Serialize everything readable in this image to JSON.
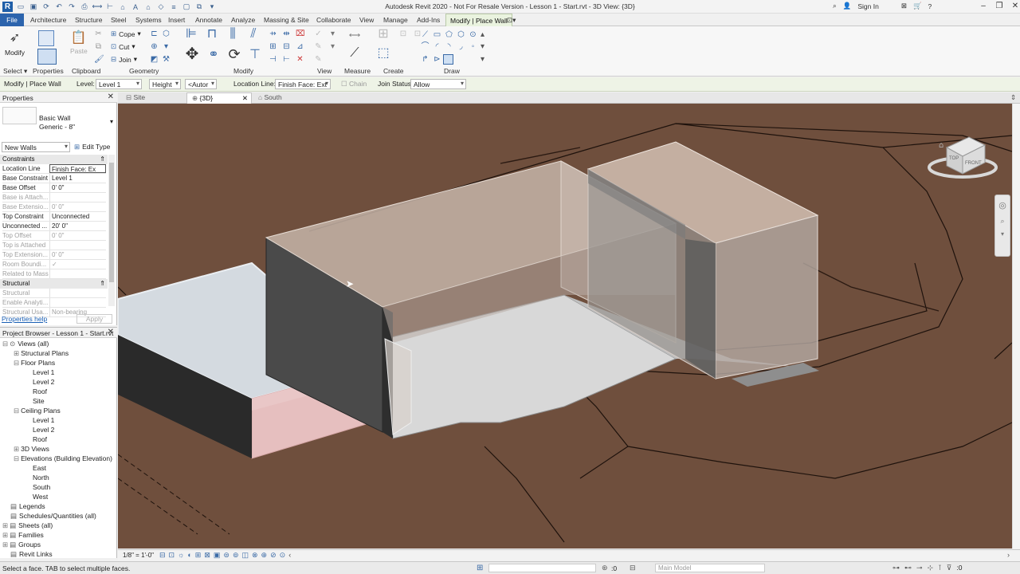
{
  "app": {
    "title": "Autodesk Revit 2020 - Not For Resale Version - Lesson 1 - Start.rvt - 3D View: {3D}",
    "sign_in": "Sign In"
  },
  "menu_tabs": [
    "File",
    "Architecture",
    "Structure",
    "Steel",
    "Systems",
    "Insert",
    "Annotate",
    "Analyze",
    "Massing & Site",
    "Collaborate",
    "View",
    "Manage",
    "Add-Ins",
    "Modify | Place Wall"
  ],
  "ribbon": {
    "modify": "Modify",
    "paste": "Paste",
    "cope": "Cope",
    "cut": "Cut",
    "join": "Join",
    "panels": {
      "select": "Select",
      "properties": "Properties",
      "clipboard": "Clipboard",
      "geometry": "Geometry",
      "modify": "Modify",
      "view": "View",
      "measure": "Measure",
      "create": "Create",
      "draw": "Draw"
    }
  },
  "options_bar": {
    "context": "Modify | Place Wall",
    "level_label": "Level:",
    "level_value": "Level 1",
    "height_value": "Height",
    "autor_value": "<Autor",
    "location_label": "Location Line:",
    "location_value": "Finish Face: Ext",
    "chain": "Chain",
    "join_label": "Join Status:",
    "join_value": "Allow"
  },
  "properties": {
    "header": "Properties",
    "type_family": "Basic Wall",
    "type_name": "Generic - 8\"",
    "filter": "New Walls",
    "edit_type": "Edit Type",
    "constraints_title": "Constraints",
    "rows": [
      {
        "k": "Location Line",
        "v": "Finish Face: Ex",
        "dis": false
      },
      {
        "k": "Base Constraint",
        "v": "Level 1",
        "dis": false
      },
      {
        "k": "Base Offset",
        "v": "0'  0\"",
        "dis": false
      },
      {
        "k": "Base is Attach...",
        "v": "",
        "dis": true
      },
      {
        "k": "Base Extensio...",
        "v": "0'  0\"",
        "dis": true
      },
      {
        "k": "Top Constraint",
        "v": "Unconnected",
        "dis": false
      },
      {
        "k": "Unconnected ...",
        "v": "20'  0\"",
        "dis": false
      },
      {
        "k": "Top Offset",
        "v": "0'  0\"",
        "dis": true
      },
      {
        "k": "Top is Attached",
        "v": "",
        "dis": true
      },
      {
        "k": "Top Extension...",
        "v": "0'  0\"",
        "dis": true
      },
      {
        "k": "Room Boundi...",
        "v": "✓",
        "dis": true
      },
      {
        "k": "Related to Mass",
        "v": "",
        "dis": true
      }
    ],
    "structural_title": "Structural",
    "structural_rows": [
      {
        "k": "Structural",
        "v": "",
        "dis": true
      },
      {
        "k": "Enable Analyti...",
        "v": "",
        "dis": true
      },
      {
        "k": "Structural Usa...",
        "v": "Non-bearing",
        "dis": true
      }
    ],
    "help": "Properties help",
    "apply": "Apply"
  },
  "browser": {
    "header": "Project Browser - Lesson 1 - Start.rvt",
    "items": [
      {
        "label": "Views (all)",
        "indent": 0,
        "exp": "⊟"
      },
      {
        "label": "Structural Plans",
        "indent": 1,
        "exp": "⊞"
      },
      {
        "label": "Floor Plans",
        "indent": 1,
        "exp": "⊟"
      },
      {
        "label": "Level 1",
        "indent": 2,
        "exp": ""
      },
      {
        "label": "Level 2",
        "indent": 2,
        "exp": ""
      },
      {
        "label": "Roof",
        "indent": 2,
        "exp": ""
      },
      {
        "label": "Site",
        "indent": 2,
        "exp": ""
      },
      {
        "label": "Ceiling Plans",
        "indent": 1,
        "exp": "⊟"
      },
      {
        "label": "Level 1",
        "indent": 2,
        "exp": ""
      },
      {
        "label": "Level 2",
        "indent": 2,
        "exp": ""
      },
      {
        "label": "Roof",
        "indent": 2,
        "exp": ""
      },
      {
        "label": "3D Views",
        "indent": 1,
        "exp": "⊞"
      },
      {
        "label": "Elevations (Building Elevation)",
        "indent": 1,
        "exp": "⊟"
      },
      {
        "label": "East",
        "indent": 2,
        "exp": ""
      },
      {
        "label": "North",
        "indent": 2,
        "exp": ""
      },
      {
        "label": "South",
        "indent": 2,
        "exp": ""
      },
      {
        "label": "West",
        "indent": 2,
        "exp": ""
      },
      {
        "label": "Legends",
        "indent": 0,
        "exp": ""
      },
      {
        "label": "Schedules/Quantities (all)",
        "indent": 0,
        "exp": ""
      },
      {
        "label": "Sheets (all)",
        "indent": 0,
        "exp": "⊞"
      },
      {
        "label": "Families",
        "indent": 0,
        "exp": "⊞"
      },
      {
        "label": "Groups",
        "indent": 0,
        "exp": "⊞"
      },
      {
        "label": "Revit Links",
        "indent": 0,
        "exp": ""
      }
    ]
  },
  "view_tabs": [
    "Site",
    "{3D}",
    "South"
  ],
  "viewcube": {
    "top": "TOP",
    "front": "FRONT"
  },
  "view_control": {
    "scale": "1/8\" = 1'-0\""
  },
  "status": {
    "message": "Select a face.  TAB to select multiple faces.",
    "workset": ":0",
    "model": "Main Model",
    "filter": ":0"
  },
  "colors": {
    "file_tab": "#2c64ad",
    "context_tab": "#eaf3df",
    "ground": "#6f4f3d",
    "options_bar": "#eef3e6"
  }
}
